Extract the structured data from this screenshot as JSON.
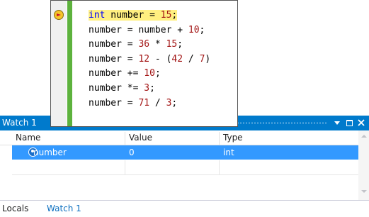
{
  "watch_window": {
    "title": "Watch 1",
    "columns": {
      "name": "Name",
      "value": "Value",
      "type": "Type"
    },
    "rows": [
      {
        "name": "number",
        "value": "0",
        "type": "int",
        "selected": true
      }
    ],
    "tabs": [
      {
        "label": "Locals",
        "active": false
      },
      {
        "label": "Watch 1",
        "active": true
      }
    ]
  },
  "code_popup": {
    "lines": [
      {
        "parts": [
          {
            "t": "int",
            "k": "kw"
          },
          {
            "t": " number = ",
            "k": ""
          },
          {
            "t": "15",
            "k": "num"
          },
          {
            "t": ";",
            "k": ""
          }
        ],
        "current": true
      },
      {
        "parts": [
          {
            "t": "number = number + ",
            "k": ""
          },
          {
            "t": "10",
            "k": "num"
          },
          {
            "t": ";",
            "k": ""
          }
        ]
      },
      {
        "parts": [
          {
            "t": "number = ",
            "k": ""
          },
          {
            "t": "36",
            "k": "num"
          },
          {
            "t": " * ",
            "k": ""
          },
          {
            "t": "15",
            "k": "num"
          },
          {
            "t": ";",
            "k": ""
          }
        ]
      },
      {
        "parts": [
          {
            "t": "number = ",
            "k": ""
          },
          {
            "t": "12",
            "k": "num"
          },
          {
            "t": " - (",
            "k": ""
          },
          {
            "t": "42",
            "k": "num"
          },
          {
            "t": " / ",
            "k": ""
          },
          {
            "t": "7",
            "k": "num"
          },
          {
            "t": ")",
            "k": ""
          }
        ]
      },
      {
        "parts": [
          {
            "t": "number += ",
            "k": ""
          },
          {
            "t": "10",
            "k": "num"
          },
          {
            "t": ";",
            "k": ""
          }
        ]
      },
      {
        "parts": [
          {
            "t": "number *= ",
            "k": ""
          },
          {
            "t": "3",
            "k": "num"
          },
          {
            "t": ";",
            "k": ""
          }
        ]
      },
      {
        "parts": [
          {
            "t": "number = ",
            "k": ""
          },
          {
            "t": "71",
            "k": "num"
          },
          {
            "t": " / ",
            "k": ""
          },
          {
            "t": "3",
            "k": "num"
          },
          {
            "t": ";",
            "k": ""
          }
        ]
      }
    ]
  },
  "icons": {
    "instruction_pointer": "current-statement-arrow-icon",
    "variable": "local-variable-icon",
    "dropdown": "chevron-down-icon",
    "restore": "restore-window-icon",
    "close": "close-icon"
  },
  "colors": {
    "title_bar": "#007acc",
    "selection": "#3399ff",
    "current_line": "#ffef80",
    "change_bar": "#5db23d",
    "keyword": "#0000ff",
    "number_literal": "#a31515"
  }
}
